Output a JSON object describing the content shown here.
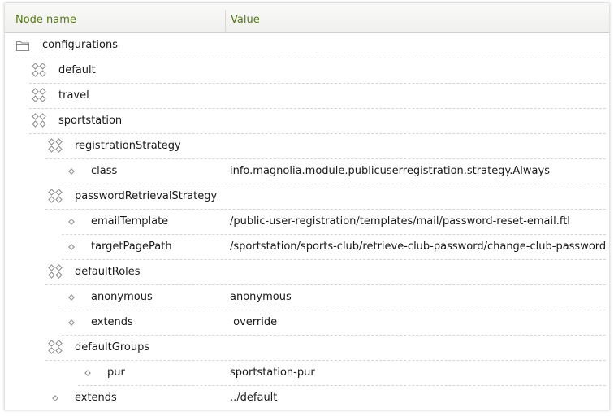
{
  "header": {
    "name_label": "Node name",
    "value_label": "Value"
  },
  "colors": {
    "header_text": "#557a12",
    "icon_stroke": "#8a8a8a",
    "separator": "#d6d6d6"
  },
  "tree": {
    "rows": [
      {
        "name": "configurations",
        "value": "",
        "icon": "folder-icon"
      },
      {
        "name": "default",
        "value": "",
        "icon": "content-node-icon"
      },
      {
        "name": "travel",
        "value": "",
        "icon": "content-node-icon"
      },
      {
        "name": "sportstation",
        "value": "",
        "icon": "content-node-icon"
      },
      {
        "name": "registrationStrategy",
        "value": "",
        "icon": "content-node-icon"
      },
      {
        "name": "class",
        "value": "info.magnolia.module.publicuserregistration.strategy.Always",
        "icon": "property-icon"
      },
      {
        "name": "passwordRetrievalStrategy",
        "value": "",
        "icon": "content-node-icon"
      },
      {
        "name": "emailTemplate",
        "value": "/public-user-registration/templates/mail/password-reset-email.ftl",
        "icon": "property-icon"
      },
      {
        "name": "targetPagePath",
        "value": "/sportstation/sports-club/retrieve-club-password/change-club-password",
        "icon": "property-icon"
      },
      {
        "name": "defaultRoles",
        "value": "",
        "icon": "content-node-icon"
      },
      {
        "name": "anonymous",
        "value": "anonymous",
        "icon": "property-icon"
      },
      {
        "name": "extends",
        "value": " override",
        "icon": "property-icon"
      },
      {
        "name": "defaultGroups",
        "value": "",
        "icon": "content-node-icon"
      },
      {
        "name": "pur",
        "value": "sportstation-pur",
        "icon": "property-icon"
      },
      {
        "name": "extends",
        "value": "../default",
        "icon": "property-icon"
      }
    ]
  }
}
